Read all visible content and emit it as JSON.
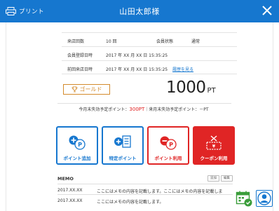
{
  "header": {
    "print_label": "プリント",
    "customer_name": "山田太郎様"
  },
  "info": {
    "visits_label": "来店回数",
    "visits_value": "10 回",
    "status_label": "会員状態",
    "status_value": "通常",
    "registered_label": "会員登録日時",
    "registered_value": "2017 年 XX 月 XX 日 15:35:25",
    "last_visit_label": "前回来店日時",
    "last_visit_value": "2017 年 XX 月 XX 日 15:35:25",
    "history_link": "履歴を見る"
  },
  "rank": {
    "label": "ゴールド",
    "color": "#d38a2c"
  },
  "points": {
    "value": "1000",
    "unit": "PT"
  },
  "expiry": {
    "this_month_label": "今月末失効予定ポイント：",
    "this_month_value": "300PT",
    "separator": "｜",
    "next_month_label": "来月末失効予定ポイント：",
    "next_month_value": "－PT"
  },
  "actions": {
    "add_points": "ポイント追加",
    "special_points": "特定ポイント",
    "use_points": "ポイント利用",
    "use_coupon": "クーポン利用"
  },
  "memo": {
    "title": "MEMO",
    "add_label": "追加",
    "edit_label": "編集",
    "rows": [
      {
        "date": "2017.XX.XX",
        "text": "ここにはメモの内容を記載します。ここにはメモの内容を記載しま"
      },
      {
        "date": "2017.XX.XX",
        "text": "ここにはメモの内容を記載します。"
      }
    ]
  },
  "colors": {
    "primary": "#1677cf",
    "danger": "#e02525",
    "gold": "#d38a2c",
    "expiry_highlight": "#e02020"
  }
}
